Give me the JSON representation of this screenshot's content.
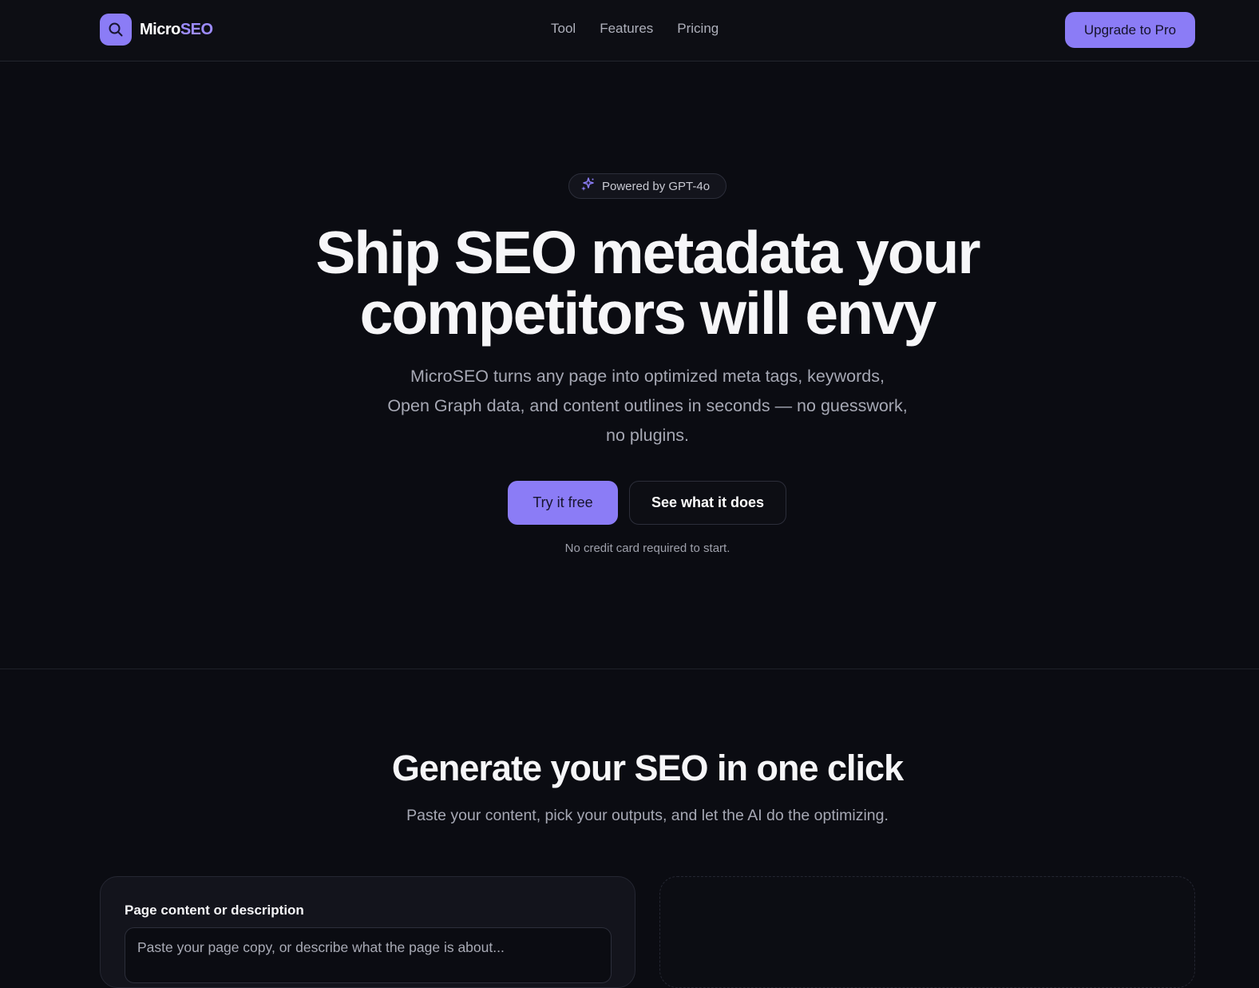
{
  "brand": {
    "name_part1": "Micro",
    "name_part2": "SEO"
  },
  "nav": {
    "links": [
      "Tool",
      "Features",
      "Pricing"
    ],
    "cta": "Upgrade to Pro"
  },
  "hero": {
    "badge": "Powered by GPT-4o",
    "title_line1": "Ship SEO metadata your",
    "title_line2": "competitors will envy",
    "subtitle_line1": "MicroSEO turns any page into optimized meta tags, keywords,",
    "subtitle_line2": "Open Graph data, and content outlines in seconds — no guesswork,",
    "subtitle_line3": "no plugins.",
    "primary_cta": "Try it free",
    "secondary_cta": "See what it does",
    "note": "No credit card required to start."
  },
  "generator": {
    "title": "Generate your SEO in one click",
    "subtitle": "Paste your content, pick your outputs, and let the AI do the optimizing.",
    "field_label": "Page content or description",
    "field_placeholder": "Paste your page copy, or describe what the page is about..."
  },
  "colors": {
    "accent": "#8b7cf6",
    "background": "#0b0c12",
    "accent_text": "#9d8cff"
  },
  "icons": {
    "logo": "search-icon",
    "badge": "sparkles-icon"
  }
}
